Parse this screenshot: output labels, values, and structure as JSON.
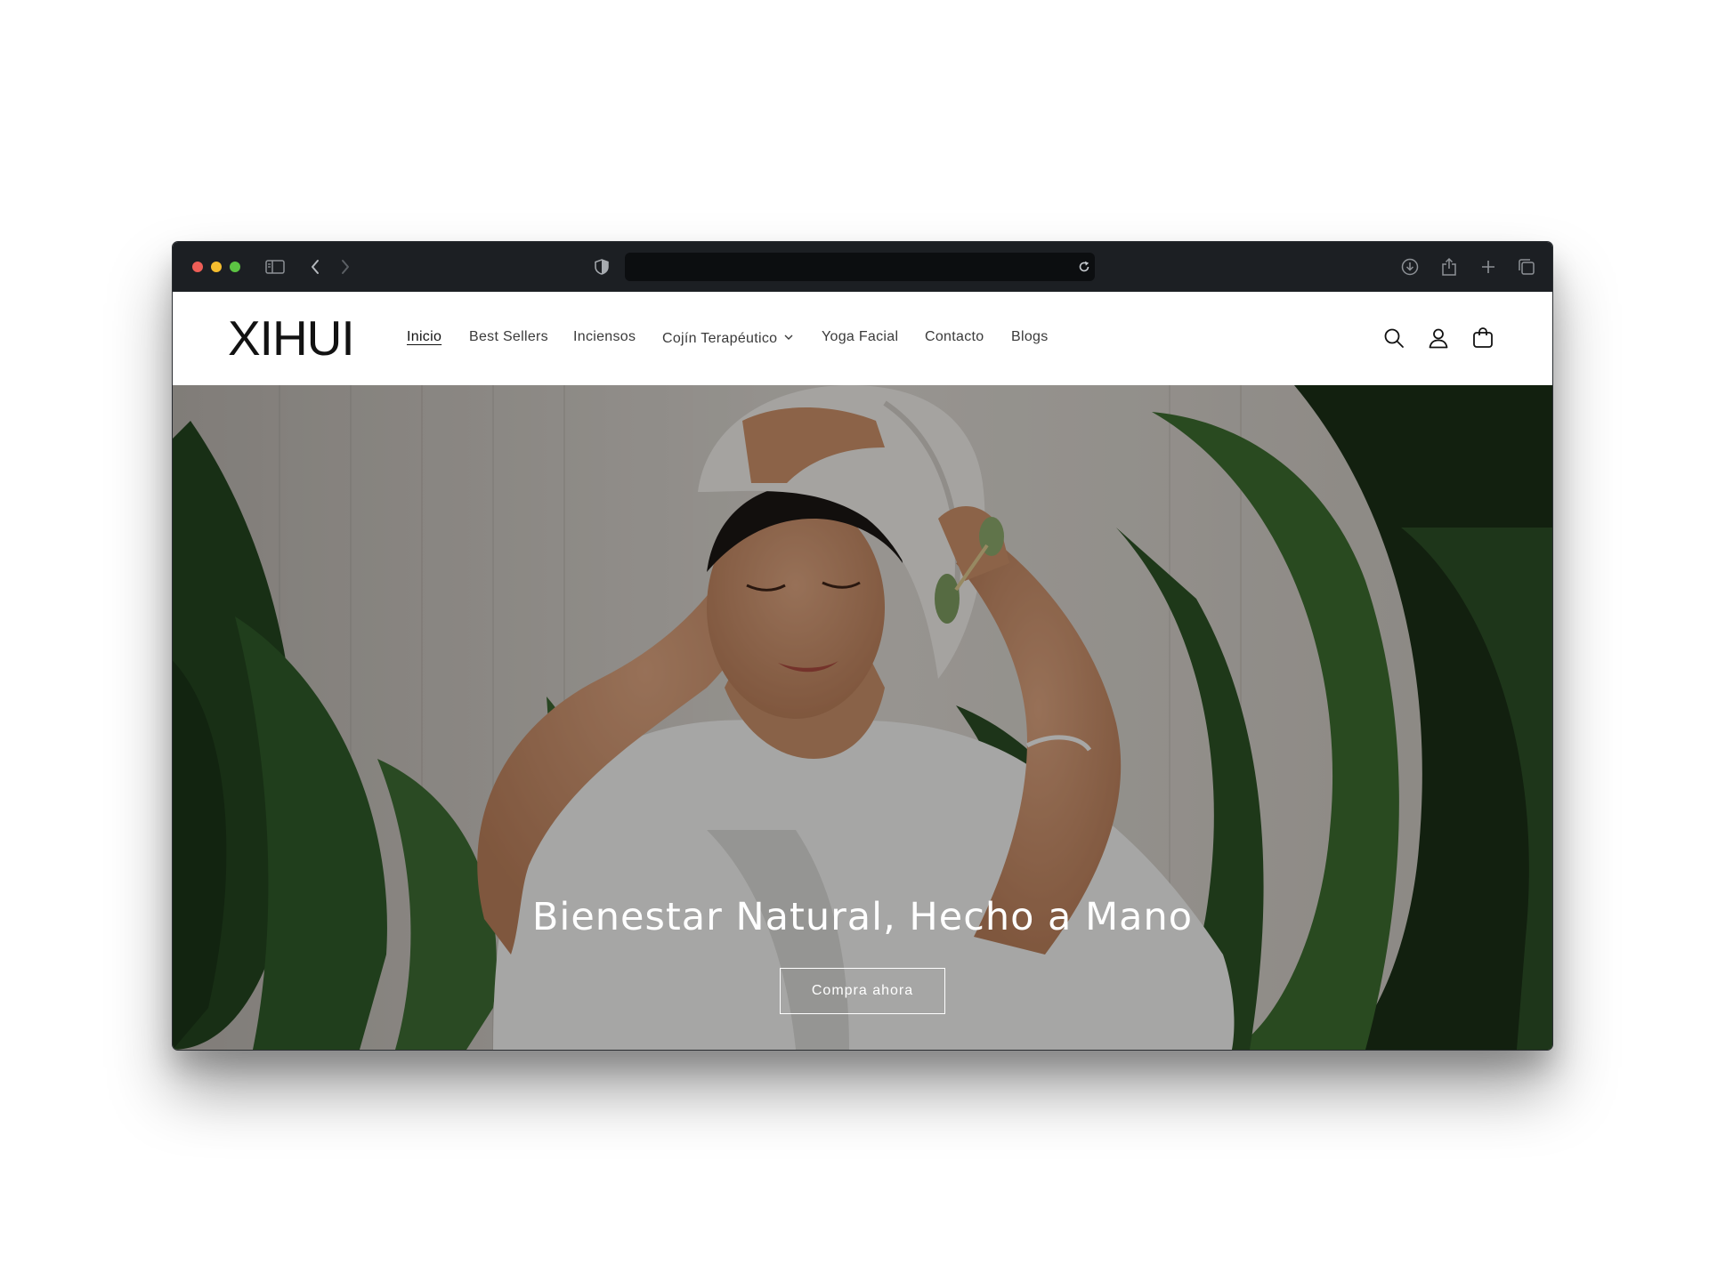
{
  "browser": {
    "url": "",
    "icons": {
      "sidebar": "sidebar-icon",
      "back": "chevron-left-icon",
      "forward": "chevron-right-icon",
      "privacy": "shield-icon",
      "reload": "reload-icon",
      "downloads": "download-icon",
      "share": "share-icon",
      "new_tab": "plus-icon",
      "tabs": "tabs-overview-icon"
    }
  },
  "header": {
    "logo": "XIHUI",
    "nav": [
      {
        "label": "Inicio",
        "active": true
      },
      {
        "label": "Best Sellers"
      },
      {
        "label": "Inciensos"
      },
      {
        "label": "Cojín Terapéutico",
        "has_dropdown": true
      },
      {
        "label": "Yoga Facial"
      },
      {
        "label": "Contacto"
      },
      {
        "label": "Blogs"
      }
    ],
    "icons": {
      "search": "search-icon",
      "account": "user-icon",
      "cart": "cart-icon"
    }
  },
  "hero": {
    "title": "Bienestar Natural, Hecho a Mano",
    "cta": "Compra ahora"
  },
  "colors": {
    "chrome_bg": "#1c1f23",
    "header_bg": "#ffffff",
    "text_dark": "#121212",
    "hero_text": "#ffffff"
  }
}
